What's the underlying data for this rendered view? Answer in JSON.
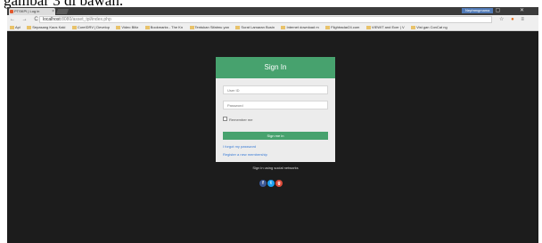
{
  "caption": "gambar 3 di bawah.",
  "browser": {
    "tab_title": "PTSKPI | Log in",
    "tab_close": "×",
    "user_badge": "Nephongmama",
    "window_controls": "– ▢ ✕",
    "nav_icons": "← → C ⌂",
    "url_host": "localhost",
    "url_path": ":8080/asset_tpl/index.php",
    "right_icons": {
      "star": "☆",
      "ext": "●",
      "menu": "≡"
    },
    "bookmarks": [
      "Apl",
      "Sepasang Kaos Kaki",
      "CoreIDRV | Develop",
      "Video Blitz",
      "Bookmarks - The Kn",
      "Tentukan Sifatmu yan",
      "Surat Lamaran Busin",
      "Internet download m",
      "Flightradar24.com",
      "VIEWIT and Ecer | V",
      "Vist gan ConCat ng"
    ]
  },
  "login": {
    "header": "Sign In",
    "user_id_placeholder": "User ID",
    "password_placeholder": "Password",
    "remember_label": "Remember me",
    "submit_label": "Sign me in",
    "forgot_link": "I forgot my password",
    "register_link": "Register a new membership",
    "social_label": "Sign in using social networks",
    "social": [
      {
        "name": "facebook",
        "glyph": "f",
        "color": "#3b5998"
      },
      {
        "name": "twitter",
        "glyph": "t",
        "color": "#1da1f2"
      },
      {
        "name": "google",
        "glyph": "g",
        "color": "#dd4b39"
      }
    ]
  }
}
